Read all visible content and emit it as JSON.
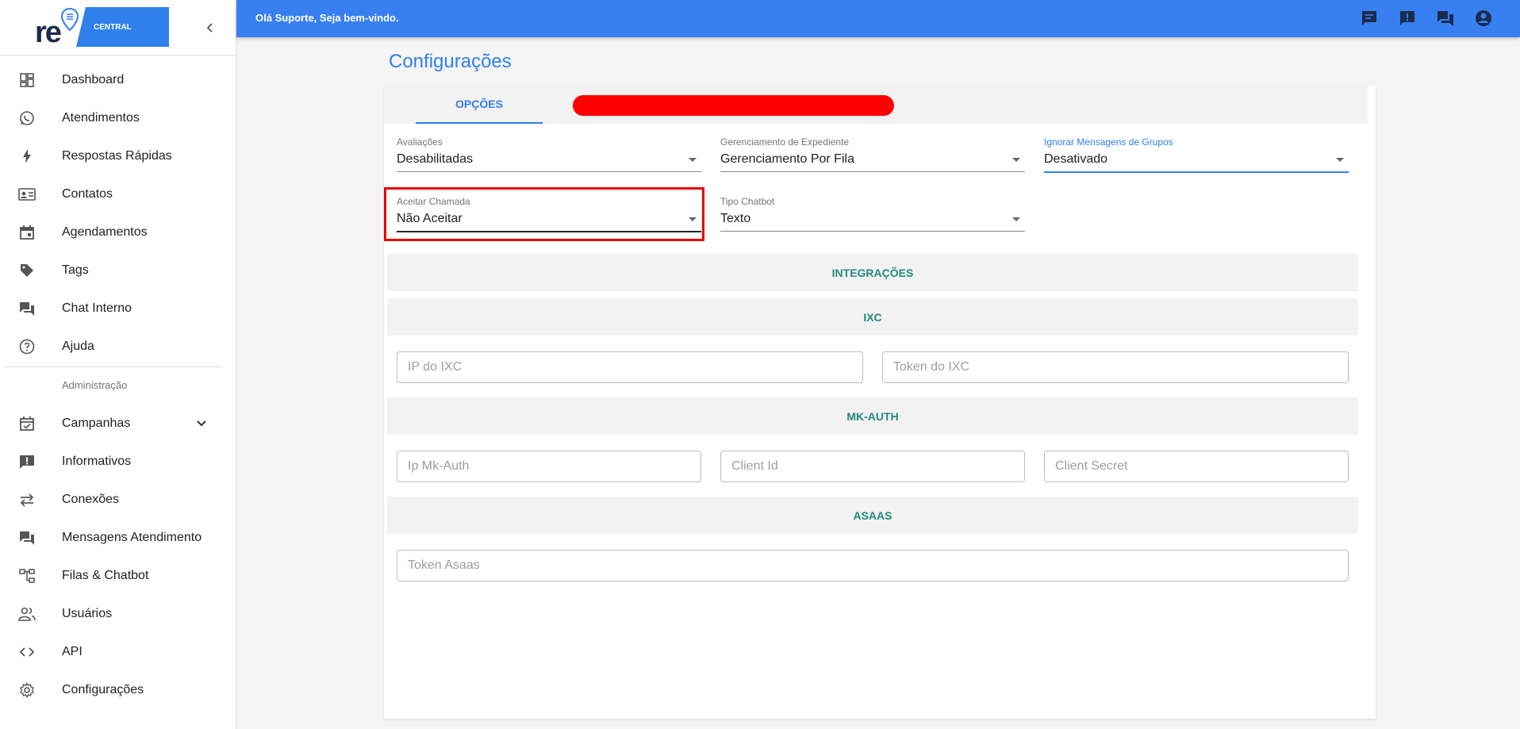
{
  "sidebar": {
    "logo_text": "re",
    "logo_banner": "CENTRAL",
    "items": [
      {
        "label": "Dashboard",
        "icon": "dashboard-icon"
      },
      {
        "label": "Atendimentos",
        "icon": "whatsapp-icon"
      },
      {
        "label": "Respostas Rápidas",
        "icon": "flash-icon"
      },
      {
        "label": "Contatos",
        "icon": "contact-card-icon"
      },
      {
        "label": "Agendamentos",
        "icon": "calendar-icon"
      },
      {
        "label": "Tags",
        "icon": "tag-icon"
      },
      {
        "label": "Chat Interno",
        "icon": "forum-icon"
      },
      {
        "label": "Ajuda",
        "icon": "help-icon"
      }
    ],
    "admin_header": "Administração",
    "admin_items": [
      {
        "label": "Campanhas",
        "icon": "event-check-icon"
      },
      {
        "label": "Informativos",
        "icon": "announcement-icon"
      },
      {
        "label": "Conexões",
        "icon": "sync-arrows-icon"
      },
      {
        "label": "Mensagens Atendimento",
        "icon": "forum-icon"
      },
      {
        "label": "Filas & Chatbot",
        "icon": "account-tree-icon"
      },
      {
        "label": "Usuários",
        "icon": "people-icon"
      },
      {
        "label": "API",
        "icon": "code-icon"
      },
      {
        "label": "Configurações",
        "icon": "gear-icon"
      }
    ]
  },
  "topbar": {
    "greeting": "Olá Suporte, Seja bem-vindo.",
    "icons": [
      "chat-icon",
      "announcement-icon",
      "forum-icon",
      "account-circle-icon"
    ],
    "color": "#3880f1"
  },
  "page": {
    "title": "Configurações",
    "tab_label": "OPÇÕES"
  },
  "fields": {
    "avaliacoes": {
      "label": "Avaliações",
      "value": "Desabilitadas"
    },
    "expediente": {
      "label": "Gerenciamento de Expediente",
      "value": "Gerenciamento Por Fila"
    },
    "grupos": {
      "label": "Ignorar Mensagens de Grupos",
      "value": "Desativado"
    },
    "chamada": {
      "label": "Aceitar Chamada",
      "value": "Não Aceitar"
    },
    "chatbot": {
      "label": "Tipo Chatbot",
      "value": "Texto"
    }
  },
  "sections": {
    "integracoes": "INTEGRAÇÕES",
    "ixc": "IXC",
    "mkauth": "MK-AUTH",
    "asaas": "ASAAS"
  },
  "inputs": {
    "ixc_ip": {
      "placeholder": "IP do IXC"
    },
    "ixc_token": {
      "placeholder": "Token do IXC"
    },
    "mk_ip": {
      "placeholder": "Ip Mk-Auth"
    },
    "mk_client_id": {
      "placeholder": "Client Id"
    },
    "mk_client_secret": {
      "placeholder": "Client Secret"
    },
    "asaas_token": {
      "placeholder": "Token Asaas"
    }
  },
  "colors": {
    "accent": "#2f80ed",
    "section_text": "#1f8a7a",
    "highlight": "#e60000",
    "redaction": "#ff0000"
  }
}
